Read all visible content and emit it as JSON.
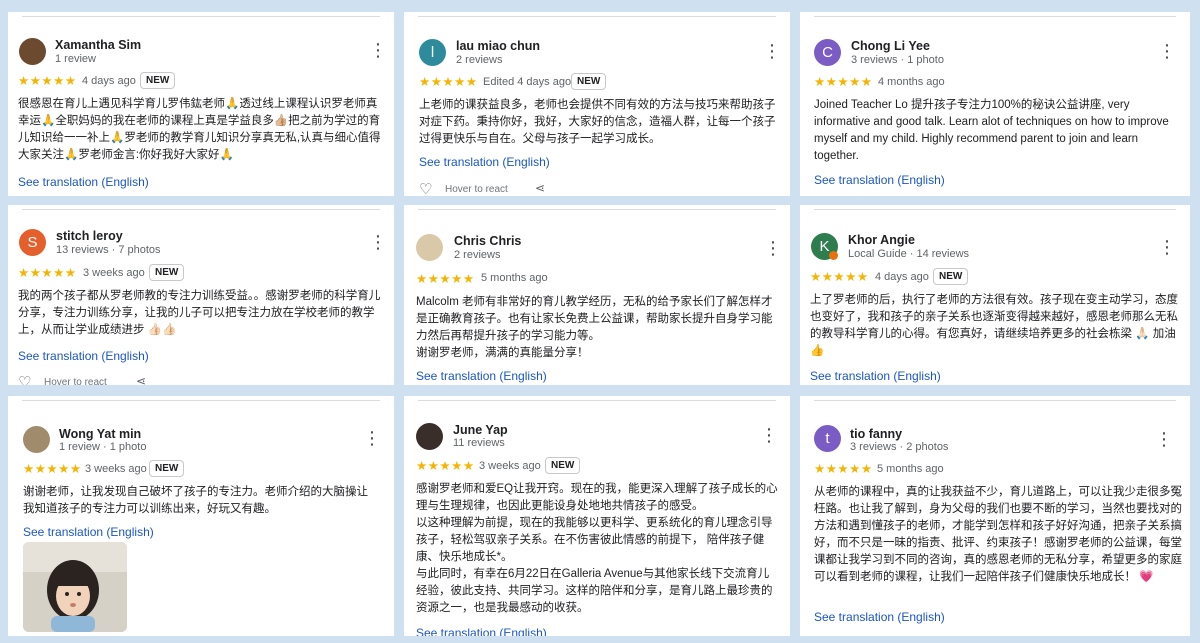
{
  "colors": {
    "background": "#cfe0f0",
    "star": "#f4b400",
    "link": "#1a55c7"
  },
  "icons": {
    "star": "star-icon",
    "menu": "more-vert-icon",
    "like": "heart-icon",
    "share": "share-icon"
  },
  "reviews": [
    {
      "name": "Xamantha Sim",
      "sub": "1 review",
      "stars": "★★★★★",
      "rating": 5,
      "when": "4 days ago",
      "badge": "NEW",
      "text": "很感恩在育儿上遇见科学育儿罗伟鈜老师🙏透过线上课程认识罗老师真幸运🙏全职妈妈的我在老师的课程上真是学益良多👍🏼把之前为学过的育儿知识给一一补上🙏罗老师的教学育儿知识分享真无私,认真与细心值得大家关注🙏罗老师金言:你好我好大家好🙏",
      "translation": "See translation (English)"
    },
    {
      "name": "lau miao chun",
      "sub": "2 reviews",
      "initial": "l",
      "stars": "★★★★★",
      "rating": 5,
      "when": "Edited 4 days ago",
      "badge": "NEW",
      "text": "上老师的课获益良多，老师也会提供不同有效的方法与技巧来帮助孩子对症下药。秉持你好，我好，大家好的信念，造福人群，让每一个孩子过得更快乐与自在。父母与孩子一起学习成长。",
      "translation": "See translation (English)",
      "react": "Hover to react"
    },
    {
      "name": "Chong Li Yee",
      "sub": "3 reviews · 1 photo",
      "initial": "C",
      "stars": "★★★★★",
      "rating": 5,
      "when": "4 months ago",
      "text": "Joined Teacher Lo 提升孩子专注力100%的秘诀公益讲座, very informative and good talk. Learn alot of techniques on how to improve myself and my child. Highly recommend parent to join and learn together.",
      "translation": "See translation (English)"
    },
    {
      "name": "stitch leroy",
      "sub": "13 reviews · 7 photos",
      "initial": "S",
      "stars": "★★★★★",
      "rating": 5,
      "when": "3 weeks ago",
      "badge": "NEW",
      "text": "我的两个孩子都从罗老师教的专注力训练受益。。感谢罗老师的科学育儿分享，专注力训练分享，让我的儿子可以把专注力放在学校老师的教学上，从而让学业成绩进步 👍🏻👍🏻",
      "translation": "See translation (English)",
      "react": "Hover to react"
    },
    {
      "name": "Chris Chris",
      "sub": "2 reviews",
      "stars": "★★★★★",
      "rating": 5,
      "when": "5 months ago",
      "text": "Malcolm 老师有非常好的育儿教学经历，无私的给予家长们了解怎样才是正确教育孩子。也有让家长免费上公益课，帮助家长提升自身学习能力然后再帮提升孩子的学习能力等。\n谢谢罗老师，满满的真能量分享！",
      "translation": "See translation (English)"
    },
    {
      "name": "Khor Angie",
      "sub": "Local Guide · 14 reviews",
      "initial": "K",
      "stars": "★★★★★",
      "rating": 5,
      "when": "4 days ago",
      "badge": "NEW",
      "text": "上了罗老师的后，执行了老师的方法很有效。孩子现在变主动学习，态度也变好了，我和孩子的亲子关系也逐渐变得越来越好，感恩老师那么无私的教导科学育儿的心得。有您真好，请继续培养更多的社会栋梁 🙏🏻 加油👍",
      "translation": "See translation (English)"
    },
    {
      "name": "Wong Yat min",
      "sub": "1 review · 1 photo",
      "stars": "★★★★★",
      "rating": 5,
      "when": "3 weeks ago",
      "badge": "NEW",
      "text": "谢谢老师，让我发现自己破坏了孩子的专注力。老师介绍的大脑操让我知道孩子的专注力可以训练出来，好玩又有趣。",
      "translation": "See translation (English)"
    },
    {
      "name": "June Yap",
      "sub": "11 reviews",
      "stars": "★★★★★",
      "rating": 5,
      "when": "3 weeks ago",
      "badge": "NEW",
      "text": "感谢罗老师和爱EQ让我开窍。现在的我，能更深入理解了孩子成长的心理与生理规律，也因此更能设身处地地共情孩子的感受。\n以这种理解为前提，现在的我能够以更科学、更系统化的育儿理念引导孩子，轻松驾驭亲子关系。在不伤害彼此情感的前提下， 陪伴孩子健康、快乐地成长*。\n与此同时，有幸在6月22日在Galleria Avenue与其他家长线下交流育儿经验，彼此支持、共同学习。这样的陪伴和分享，是育儿路上最珍贵的资源之一，也是我最感动的收获。",
      "translation": "See translation (English)"
    },
    {
      "name": "tio fanny",
      "sub": "3 reviews · 2 photos",
      "initial": "t",
      "stars": "★★★★★",
      "rating": 5,
      "when": "5 months ago",
      "text": "从老师的课程中，真的让我获益不少，育儿道路上，可以让我少走很多冤枉路。也让我了解到，身为父母的我们也要不断的学习，当然也要找对的方法和遇到懂孩子的老师，才能学到怎样和孩子好好沟通，把亲子关系搞好，而不只是一昧的指责、批评、约束孩子！感谢罗老师的公益课，每堂课都让我学习到不同的咨询，真的感恩老师的无私分享，希望更多的家庭可以看到老师的课程，让我们一起陪伴孩子们健康快乐地成长！ 💗",
      "translation": "See translation (English)"
    }
  ]
}
